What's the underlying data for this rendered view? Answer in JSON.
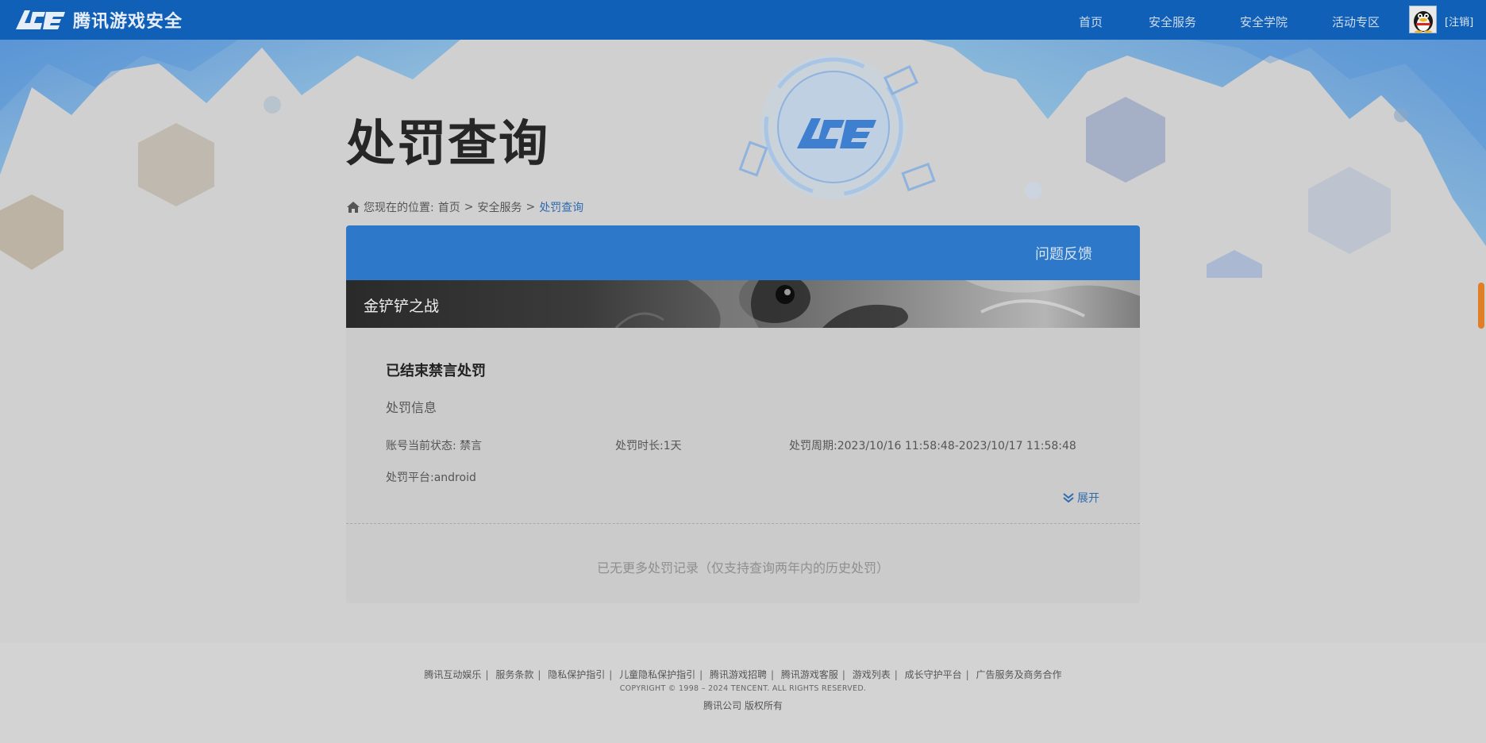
{
  "header": {
    "logo_text": "腾讯游戏安全",
    "nav": [
      "首页",
      "安全服务",
      "安全学院",
      "活动专区"
    ],
    "logout": "[注销]"
  },
  "page": {
    "title": "处罚查询",
    "breadcrumb": {
      "prefix": "您现在的位置:",
      "items": [
        "首页",
        "安全服务",
        "处罚查询"
      ]
    }
  },
  "card": {
    "feedback": "问题反馈",
    "game": "金铲铲之战",
    "record_title": "已结束禁言处罚",
    "section_label": "处罚信息",
    "fields": {
      "status": "账号当前状态:  禁言",
      "duration": "处罚时长:1天",
      "period": "处罚周期:2023/10/16 11:58:48-2023/10/17 11:58:48",
      "platform": "处罚平台:android"
    },
    "expand": "展开",
    "no_more": "已无更多处罚记录（仅支持查询两年内的历史处罚）"
  },
  "footer": {
    "links": [
      "腾讯互动娱乐",
      "服务条款",
      "隐私保护指引",
      "儿童隐私保护指引",
      "腾讯游戏招聘",
      "腾讯游戏客服",
      "游戏列表",
      "成长守护平台",
      "广告服务及商务合作"
    ],
    "copyright": "COPYRIGHT © 1998 – 2024 TENCENT. ALL RIGHTS RESERVED.",
    "company": "腾讯公司 版权所有"
  },
  "colors": {
    "topbar": "#1160b7",
    "card_header": "#2d78c9",
    "link_active": "#2f6bb0"
  }
}
